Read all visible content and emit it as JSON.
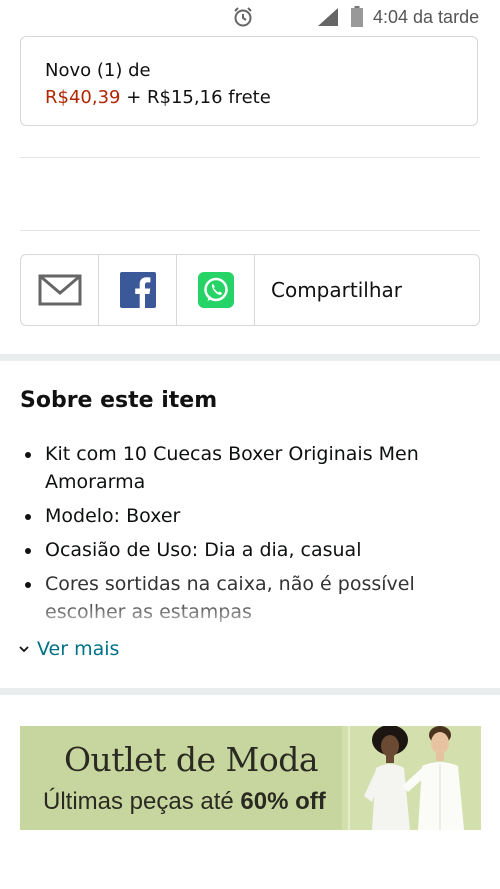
{
  "status_bar": {
    "time": "4:04 da tarde"
  },
  "offer": {
    "line1": "Novo (1) de",
    "price": "R$40,39",
    "shipping": " + R$15,16 frete"
  },
  "share": {
    "label": "Compartilhar"
  },
  "about": {
    "title": "Sobre este item",
    "bullets": [
      "Kit com 10 Cuecas Boxer Originais Men Amorarma",
      "Modelo: Boxer",
      "Ocasião de Uso: Dia a dia, casual",
      "Cores sortidas na caixa, não é possível escolher as estampas"
    ],
    "see_more": "Ver mais"
  },
  "banner": {
    "title": "Outlet de Moda",
    "subtitle_prefix": "Últimas peças até ",
    "subtitle_bold": "60% off"
  },
  "colors": {
    "price": "#b12704",
    "link": "#007185",
    "banner_bg": "#c7d69e",
    "facebook": "#3b5998",
    "whatsapp": "#25d366"
  }
}
